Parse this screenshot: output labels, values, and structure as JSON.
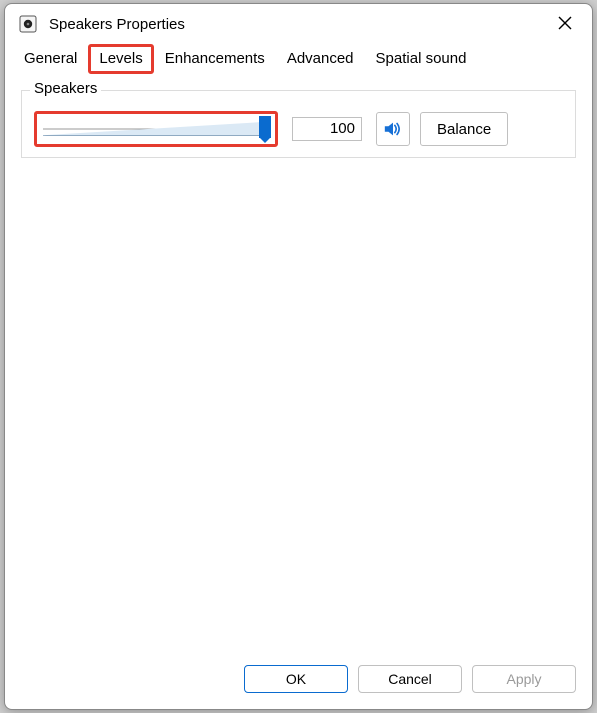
{
  "window": {
    "title": "Speakers Properties"
  },
  "tabs": {
    "general": "General",
    "levels": "Levels",
    "enhancements": "Enhancements",
    "advanced": "Advanced",
    "spatial": "Spatial sound",
    "active": "levels"
  },
  "group": {
    "title": "Speakers",
    "value": "100",
    "balance_label": "Balance"
  },
  "buttons": {
    "ok": "OK",
    "cancel": "Cancel",
    "apply": "Apply"
  },
  "colors": {
    "accent": "#0a6bcf",
    "highlight": "#e53b2e"
  }
}
